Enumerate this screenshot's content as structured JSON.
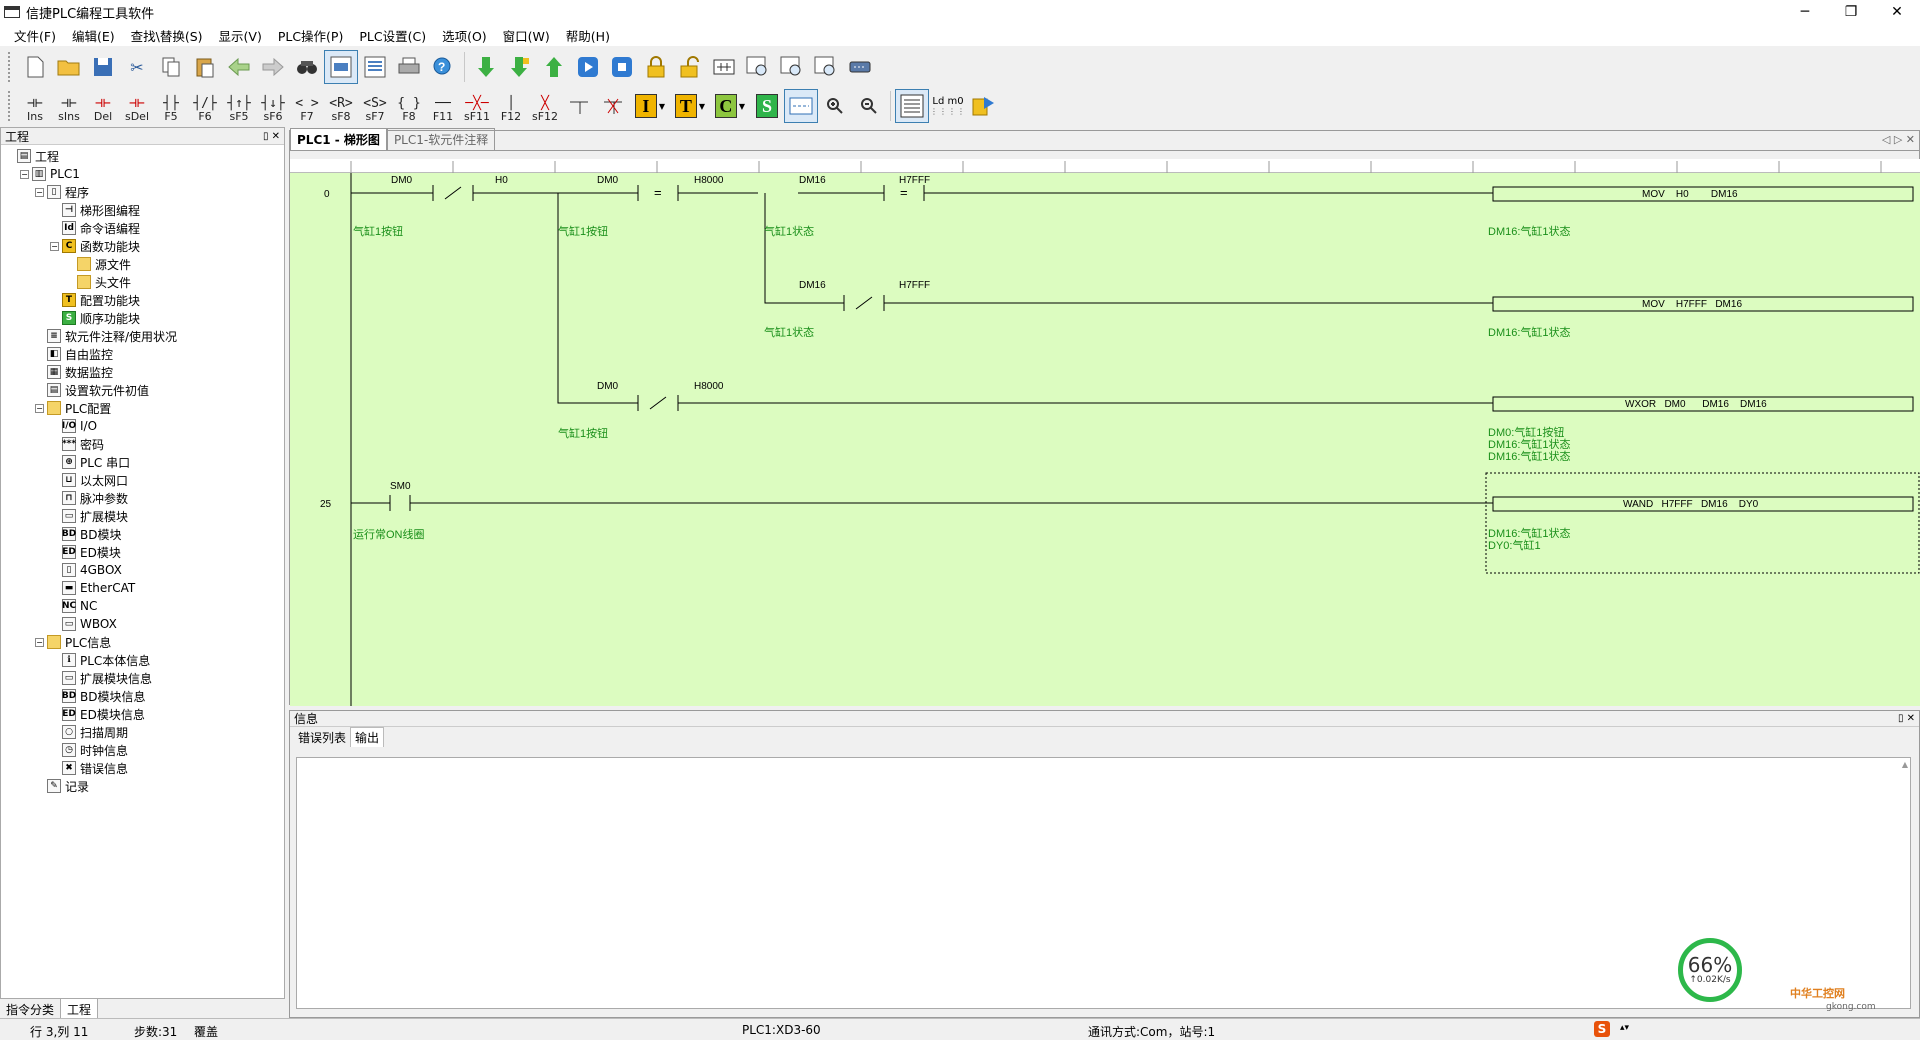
{
  "window": {
    "title": "信捷PLC编程工具软件",
    "controls": [
      "─",
      "❐",
      "✕"
    ]
  },
  "menu": [
    "文件(F)",
    "编辑(E)",
    "查找\\替换(S)",
    "显示(V)",
    "PLC操作(P)",
    "PLC设置(C)",
    "选项(O)",
    "窗口(W)",
    "帮助(H)"
  ],
  "toolbar2": {
    "items": [
      {
        "glyph": "⊣⊢",
        "key": "Ins"
      },
      {
        "glyph": "⊣⊢",
        "key": "sIns"
      },
      {
        "glyph": "⊣⊢",
        "key": "Del"
      },
      {
        "glyph": "⊣⊢",
        "key": "sDel"
      },
      {
        "glyph": "┤├",
        "key": "F5"
      },
      {
        "glyph": "┤/├",
        "key": "F6"
      },
      {
        "glyph": "┤↑├",
        "key": "sF5"
      },
      {
        "glyph": "┤↓├",
        "key": "sF6"
      },
      {
        "glyph": "< >",
        "key": "F7"
      },
      {
        "glyph": "<R>",
        "key": "sF8"
      },
      {
        "glyph": "<S>",
        "key": "sF7"
      },
      {
        "glyph": "{ }",
        "key": "F8"
      },
      {
        "glyph": "──",
        "key": "F11"
      },
      {
        "glyph": "─╳─",
        "key": "sF11"
      },
      {
        "glyph": "│",
        "key": "F12"
      },
      {
        "glyph": "╳",
        "key": "sF12"
      }
    ],
    "letter_boxes": [
      {
        "letter": "I",
        "color": "#f0b400"
      },
      {
        "letter": "T",
        "color": "#f0b400"
      },
      {
        "letter": "C",
        "color": "#8dc63f"
      },
      {
        "letter": "S",
        "color": "#2fb44a"
      }
    ],
    "ld_label": "Ld m0"
  },
  "project_panel": {
    "title": "工程",
    "pin": "▯ ✕",
    "tree": [
      {
        "label": "工程",
        "level": 0,
        "icon": "project-icon",
        "toggle": ""
      },
      {
        "label": "PLC1",
        "level": 1,
        "icon": "plc-icon",
        "toggle": "−"
      },
      {
        "label": "程序",
        "level": 2,
        "icon": "program-icon",
        "toggle": "−"
      },
      {
        "label": "梯形图编程",
        "level": 3,
        "icon": "ladder-icon",
        "toggle": ""
      },
      {
        "label": "命令语编程",
        "level": 3,
        "icon": "command-icon",
        "toggle": ""
      },
      {
        "label": "函数功能块",
        "level": 3,
        "icon": "function-block-icon",
        "toggle": "−"
      },
      {
        "label": "源文件",
        "level": 4,
        "icon": "folder-icon",
        "toggle": ""
      },
      {
        "label": "头文件",
        "level": 4,
        "icon": "folder-icon",
        "toggle": ""
      },
      {
        "label": "配置功能块",
        "level": 3,
        "icon": "config-block-icon",
        "toggle": ""
      },
      {
        "label": "顺序功能块",
        "level": 3,
        "icon": "sequence-block-icon",
        "toggle": ""
      },
      {
        "label": "软元件注释/使用状况",
        "level": 2,
        "icon": "comment-icon",
        "toggle": ""
      },
      {
        "label": "自由监控",
        "level": 2,
        "icon": "monitor-icon",
        "toggle": ""
      },
      {
        "label": "数据监控",
        "level": 2,
        "icon": "data-monitor-icon",
        "toggle": ""
      },
      {
        "label": "设置软元件初值",
        "level": 2,
        "icon": "init-value-icon",
        "toggle": ""
      },
      {
        "label": "PLC配置",
        "level": 2,
        "icon": "folder-icon",
        "toggle": "−"
      },
      {
        "label": "I/O",
        "level": 3,
        "icon": "io-icon",
        "toggle": ""
      },
      {
        "label": "密码",
        "level": 3,
        "icon": "password-icon",
        "toggle": ""
      },
      {
        "label": "PLC 串口",
        "level": 3,
        "icon": "serial-port-icon",
        "toggle": ""
      },
      {
        "label": "以太网口",
        "level": 3,
        "icon": "ethernet-icon",
        "toggle": ""
      },
      {
        "label": "脉冲参数",
        "level": 3,
        "icon": "pulse-icon",
        "toggle": ""
      },
      {
        "label": "扩展模块",
        "level": 3,
        "icon": "expansion-icon",
        "toggle": ""
      },
      {
        "label": "BD模块",
        "level": 3,
        "icon": "bd-module-icon",
        "toggle": ""
      },
      {
        "label": "ED模块",
        "level": 3,
        "icon": "ed-module-icon",
        "toggle": ""
      },
      {
        "label": "4GBOX",
        "level": 3,
        "icon": "4gbox-icon",
        "toggle": ""
      },
      {
        "label": "EtherCAT",
        "level": 3,
        "icon": "ethercat-icon",
        "toggle": ""
      },
      {
        "label": "NC",
        "level": 3,
        "icon": "nc-icon",
        "toggle": ""
      },
      {
        "label": "WBOX",
        "level": 3,
        "icon": "wbox-icon",
        "toggle": ""
      },
      {
        "label": "PLC信息",
        "level": 2,
        "icon": "folder-icon",
        "toggle": "−"
      },
      {
        "label": "PLC本体信息",
        "level": 3,
        "icon": "plc-info-icon",
        "toggle": ""
      },
      {
        "label": "扩展模块信息",
        "level": 3,
        "icon": "expansion-info-icon",
        "toggle": ""
      },
      {
        "label": "BD模块信息",
        "level": 3,
        "icon": "bd-info-icon",
        "toggle": ""
      },
      {
        "label": "ED模块信息",
        "level": 3,
        "icon": "ed-info-icon",
        "toggle": ""
      },
      {
        "label": "扫描周期",
        "level": 3,
        "icon": "scan-cycle-icon",
        "toggle": ""
      },
      {
        "label": "时钟信息",
        "level": 3,
        "icon": "clock-icon",
        "toggle": ""
      },
      {
        "label": "错误信息",
        "level": 3,
        "icon": "error-icon",
        "toggle": ""
      },
      {
        "label": "记录",
        "level": 2,
        "icon": "record-icon",
        "toggle": ""
      }
    ],
    "tabs": [
      "指令分类",
      "工程"
    ]
  },
  "editor": {
    "tabs": [
      "PLC1 - 梯形图",
      "PLC1-软元件注释"
    ],
    "tab_controls": "◁ ▷ ✕",
    "rungs": [
      {
        "step": "0",
        "contacts": [
          {
            "dev": "DM0",
            "kind": "nc",
            "comment": "气缸1按钮"
          },
          {
            "dev": "H0",
            "kind": "label"
          },
          {
            "dev": "DM0",
            "kind": "eq",
            "dev2": "H8000",
            "comment": "气缸1按钮"
          },
          {
            "dev": "DM16",
            "kind": "eq",
            "dev2": "H7FFF",
            "comment": "气缸1状态"
          }
        ]
      },
      {
        "step": "25"
      }
    ],
    "labels": {
      "dm0": "DM0",
      "h0": "H0",
      "h8000": "H8000",
      "dm16": "DM16",
      "h7fff": "H7FFF",
      "sm0": "SM0",
      "eq": "=",
      "nc": "⧸",
      "c_btn": "气缸1按钮",
      "c_state": "气缸1状态",
      "c_sm0": "运行常ON线圈",
      "i1": "MOV    H0        DM16",
      "i1c": "DM16:气缸1状态",
      "i2": "MOV    H7FFF   DM16",
      "i2c": "DM16:气缸1状态",
      "i3": "WXOR   DM0      DM16    DM16",
      "i3c1": "DM0:气缸1按钮",
      "i3c2": "DM16:气缸1状态",
      "i3c3": "DM16:气缸1状态",
      "i4": "WAND   H7FFF   DM16    DY0",
      "i4c1": "DM16:气缸1状态",
      "i4c2": "DY0:气缸1",
      "step0": "0",
      "step25": "25"
    }
  },
  "info_panel": {
    "title": "信息",
    "pin": "▯ ✕",
    "tabs": [
      "错误列表",
      "输出"
    ]
  },
  "net_widget": {
    "percent": "66%",
    "speed": "↑0.02K/s"
  },
  "watermark": {
    "brand": "中华工控网",
    "url": "gkong.com"
  },
  "status": {
    "pos": "行 3,列 11",
    "steps": "步数:31",
    "mode": "覆盖",
    "plc": "PLC1:XD3-60",
    "comm": "通讯方式:Com，站号:1"
  }
}
